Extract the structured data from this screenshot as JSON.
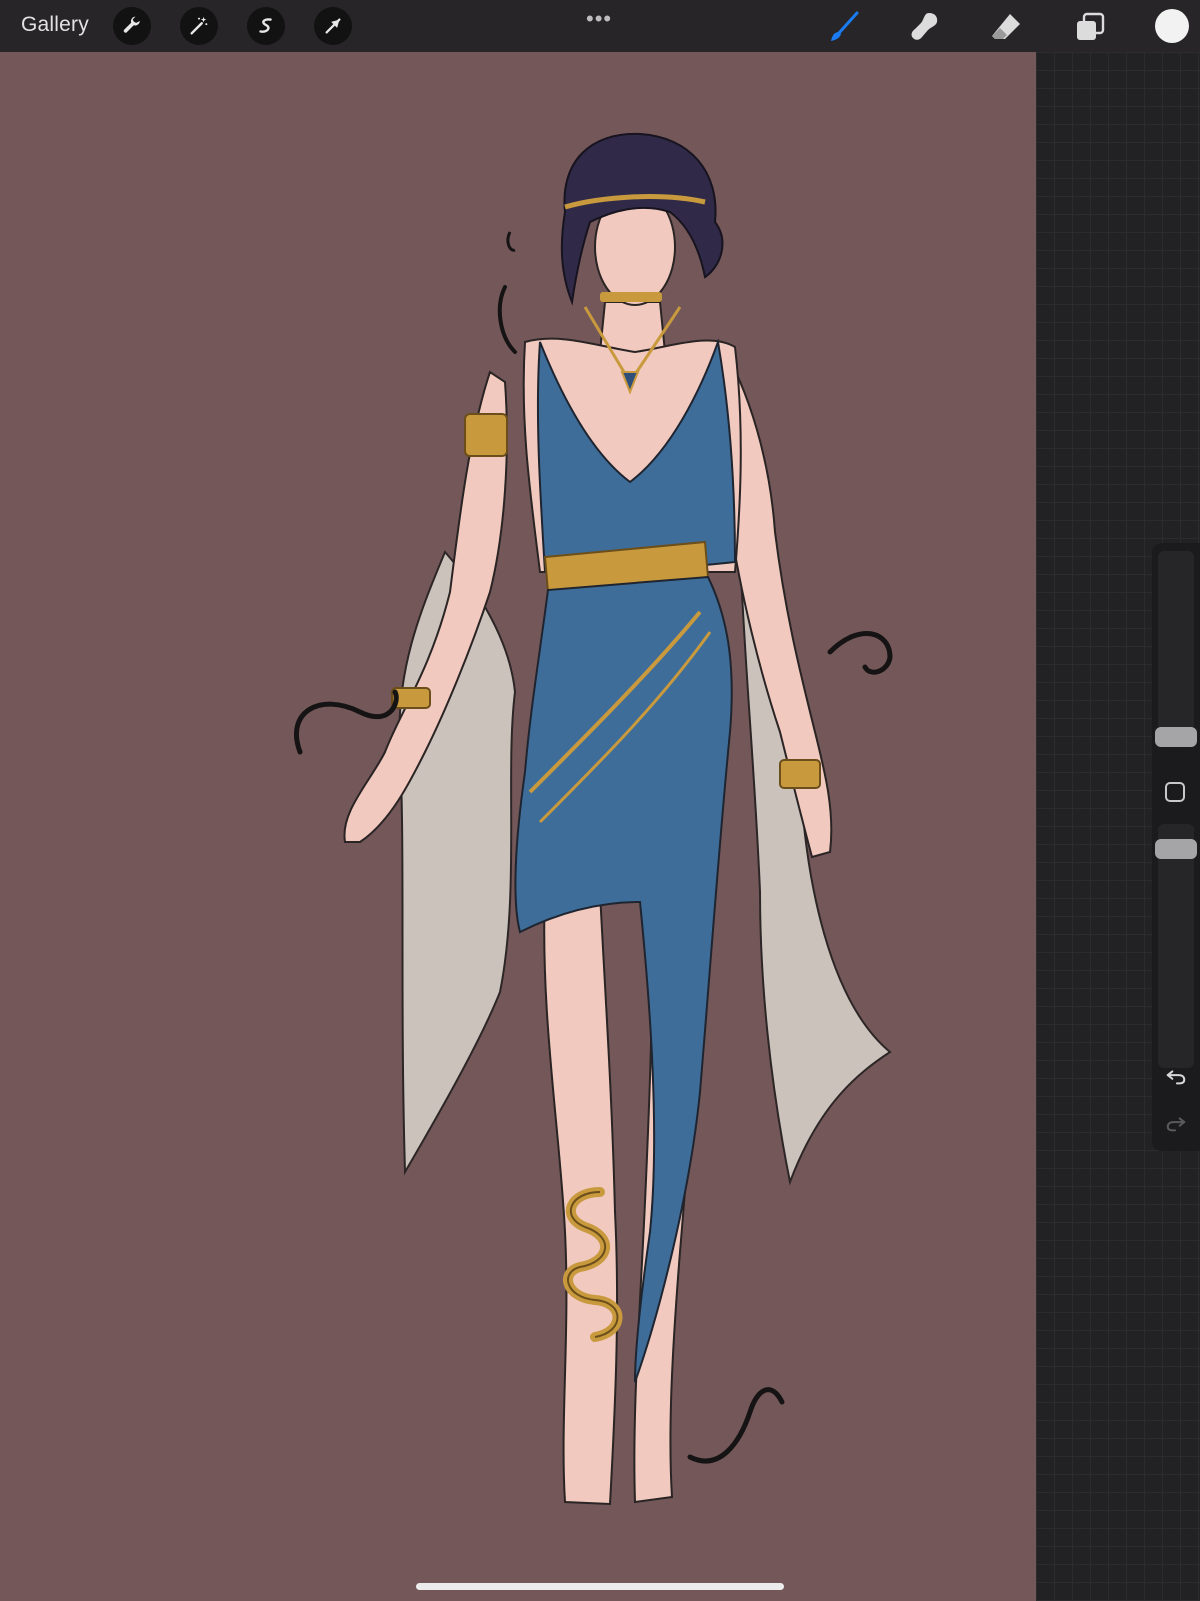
{
  "topbar": {
    "gallery_label": "Gallery",
    "left_tools": [
      "wrench-icon",
      "magic-wand-icon",
      "selection-icon",
      "transform-arrow-icon"
    ],
    "more_indicator": "•••",
    "right_tools": [
      "brush-icon",
      "smudge-icon",
      "eraser-icon",
      "layers-icon"
    ],
    "active_tool": "brush-icon",
    "active_tool_color": "#1a7bf2",
    "current_color": "#f2f2f2"
  },
  "canvas": {
    "background_color": "#745759",
    "artwork": "character-sketch"
  },
  "sidebar": {
    "brush_size_level": 0.73,
    "opacity_level": 0.42,
    "icons": [
      "modify-square-icon",
      "undo-icon",
      "redo-icon"
    ]
  }
}
